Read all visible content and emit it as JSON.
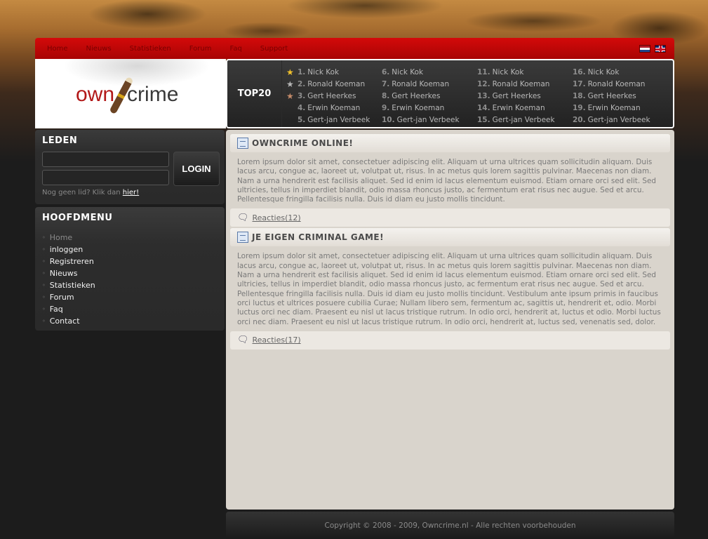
{
  "nav": {
    "items": [
      "Home",
      "Nieuws",
      "Statistieken",
      "Forum",
      "Faq",
      "Support"
    ]
  },
  "flags": {
    "nl": "flag-nl-icon",
    "en": "flag-uk-icon"
  },
  "logo": {
    "own": "own",
    "crime": "crime"
  },
  "top20": {
    "label": "TOP20",
    "columns": [
      [
        {
          "rank": "1.",
          "name": "Nick Kok",
          "medal": "gold"
        },
        {
          "rank": "2.",
          "name": "Ronald Koeman",
          "medal": "silver"
        },
        {
          "rank": "3.",
          "name": "Gert Heerkes",
          "medal": "bronze"
        },
        {
          "rank": "4.",
          "name": "Erwin Koeman",
          "medal": "none"
        },
        {
          "rank": "5.",
          "name": "Gert-jan Verbeek",
          "medal": "none"
        }
      ],
      [
        {
          "rank": "6.",
          "name": "Nick Kok"
        },
        {
          "rank": "7.",
          "name": "Ronald Koeman"
        },
        {
          "rank": "8.",
          "name": "Gert Heerkes"
        },
        {
          "rank": "9.",
          "name": "Erwin Koeman"
        },
        {
          "rank": "10.",
          "name": "Gert-jan Verbeek"
        }
      ],
      [
        {
          "rank": "11.",
          "name": "Nick Kok"
        },
        {
          "rank": "12.",
          "name": "Ronald Koeman"
        },
        {
          "rank": "13.",
          "name": "Gert Heerkes"
        },
        {
          "rank": "14.",
          "name": "Erwin Koeman"
        },
        {
          "rank": "15.",
          "name": "Gert-jan Verbeek"
        }
      ],
      [
        {
          "rank": "16.",
          "name": "Nick Kok"
        },
        {
          "rank": "17.",
          "name": "Ronald Koeman"
        },
        {
          "rank": "18.",
          "name": "Gert Heerkes"
        },
        {
          "rank": "19.",
          "name": "Erwin Koeman"
        },
        {
          "rank": "20.",
          "name": "Gert-jan Verbeek"
        }
      ]
    ]
  },
  "login": {
    "title": "LEDEN",
    "username_value": "",
    "password_value": "",
    "button": "LOGIN",
    "note": "Nog geen lid? Klik dan",
    "link": "hier!"
  },
  "menu": {
    "title": "HOOFDMENU",
    "items": [
      "Home",
      "inloggen",
      "Registreren",
      "Nieuws",
      "Statistieken",
      "Forum",
      "Faq",
      "Contact"
    ],
    "active_index": 0
  },
  "posts": [
    {
      "title": "OWNCRIME ONLINE!",
      "body": "Lorem ipsum dolor sit amet, consectetuer adipiscing elit. Aliquam ut urna ultrices quam sollicitudin aliquam. Duis lacus arcu, congue ac, laoreet ut, volutpat ut, risus. In ac metus quis lorem sagittis pulvinar. Maecenas non diam. Nam a urna hendrerit est facilisis aliquet. Sed id enim id lacus elementum euismod. Etiam ornare orci sed elit. Sed ultricies, tellus in imperdiet blandit, odio massa rhoncus justo, ac fermentum erat risus nec augue. Sed et arcu. Pellentesque fringilla facilisis nulla. Duis id diam eu justo mollis tincidunt.",
      "comments": "Reacties(12)"
    },
    {
      "title": "JE EIGEN CRIMINAL GAME!",
      "body": "Lorem ipsum dolor sit amet, consectetuer adipiscing elit. Aliquam ut urna ultrices quam sollicitudin aliquam. Duis lacus arcu, congue ac, laoreet ut, volutpat ut, risus. In ac metus quis lorem sagittis pulvinar. Maecenas non diam. Nam a urna hendrerit est facilisis aliquet. Sed id enim id lacus elementum euismod. Etiam ornare orci sed elit. Sed ultricies, tellus in imperdiet blandit, odio massa rhoncus justo, ac fermentum erat risus nec augue. Sed et arcu. Pellentesque fringilla facilisis nulla. Duis id diam eu justo mollis tincidunt. Vestibulum ante ipsum primis in faucibus orci luctus et ultrices posuere cubilia Curae; Nullam libero sem, fermentum ac, sagittis ut, hendrerit et, odio. Morbi luctus orci nec diam. Praesent eu nisl ut lacus tristique rutrum. In odio orci, hendrerit at, luctus et odio. Morbi luctus orci nec diam. Praesent eu nisl ut lacus tristique rutrum. In odio orci, hendrerit at, luctus sed, venenatis sed, dolor.",
      "comments": "Reacties(17)"
    }
  ],
  "footer": {
    "text": "Copyright © 2008 - 2009, Owncrime.nl - Alle rechten voorbehouden"
  },
  "colors": {
    "nav_red": "#d40a0a",
    "content_bg": "#d9d4cc",
    "panel_dark": "#2d2d2d"
  }
}
